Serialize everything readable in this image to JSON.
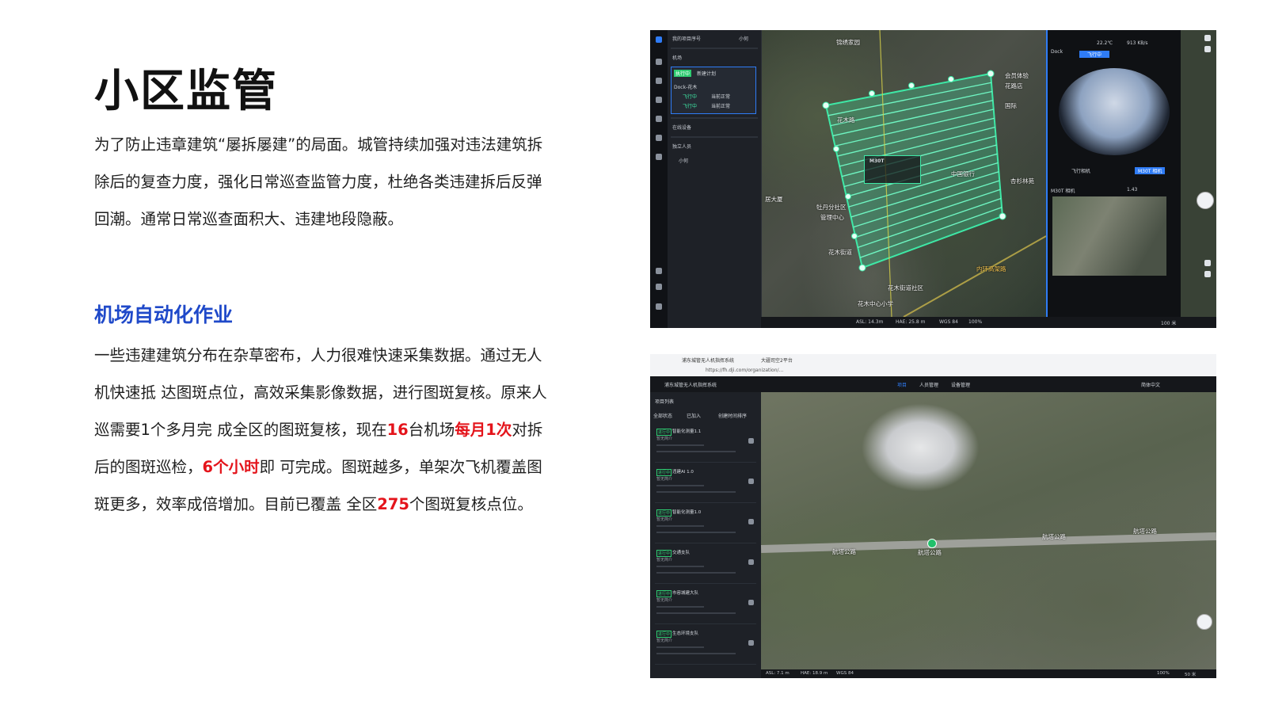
{
  "title": "小区监管",
  "intro": "为了防止违章建筑“屡拆屡建”的局面。城管持续加强对违法建筑拆除后的复查力度，强化日常巡查监管力度，杜绝各类违建拆后反弹回潮。通常日常巡查面积大、违建地段隐蔽。",
  "section_title": "机场自动化作业",
  "body": {
    "s1": "一些违建建筑分布在杂草密布，人力很难快速采集数据。通过无人机快速抵 达图斑点位，高效采集影像数据，进行图斑复核。原来人巡需要1个多月完 成全区的图斑复核，现在",
    "h1": "16",
    "s2": "台机场",
    "h2": "每月1次",
    "s3": "对拆后的图斑巡检，",
    "h3": "6个小时",
    "s4": "即  可完成。图斑越多，单架次飞机覆盖图斑更多，效率成倍增加。目前已覆盖 全区",
    "h4": "275",
    "s5": "个图斑复核点位。"
  },
  "screenshot1": {
    "panel": {
      "header": "我的项目序号",
      "user": "小何",
      "section_airport": "机场",
      "dock_name": "Dock-花木",
      "dock_status": "执行中",
      "task": "新建计划",
      "status_a": "飞行中",
      "status_b": "当前正常",
      "online_devices": "在线设备",
      "independent_members": "独立人员",
      "member": "小何"
    },
    "map_labels": [
      "锦绣家园",
      "花木路",
      "会员体验",
      "花路店",
      "国际",
      "花木街道",
      "杏杉林苑",
      "牡丹分社区",
      "管理中心",
      "居大厦",
      "中国银行",
      "花木中心小学",
      "内环高架路",
      "花木街道社区"
    ],
    "drone": "M30T",
    "right_panel": {
      "dock": "Dock",
      "status": "飞行中",
      "temp": "22.2℃",
      "speed": "913 KB/s",
      "camera": "M30T 相机",
      "mode": "飞行相机",
      "zoom": "1.43"
    },
    "status_bar": {
      "asl": "ASL: 14.3m",
      "hae": "HAE: 25.8 m",
      "crs": "WGS 84",
      "zoom": "100%",
      "scale": "100 米"
    }
  },
  "screenshot2": {
    "browser": {
      "tab1": "浦东城管无人机指挥系统",
      "tab2": "大疆司空2平台",
      "url": "https://fh.dji.com/organization/..."
    },
    "app": {
      "title": "浦东城管无人机指挥系统",
      "nav": [
        "项目",
        "人员管理",
        "设备管理"
      ],
      "lang": "简体中文"
    },
    "panel": {
      "header": "项目列表",
      "filters": [
        "全部状态",
        "已加入",
        "创建时间排序"
      ]
    },
    "cards": [
      {
        "tag": "进行中",
        "name": "智能化测量1.1",
        "sub": "暂无简介"
      },
      {
        "tag": "进行中",
        "name": "违建AI 1.0",
        "sub": "暂无简介"
      },
      {
        "tag": "进行中",
        "name": "智能化测量1.0",
        "sub": "暂无简介"
      },
      {
        "tag": "进行中",
        "name": "交通支队",
        "sub": "暂无简介"
      },
      {
        "tag": "进行中",
        "name": "市容城建大队",
        "sub": "暂无简介"
      },
      {
        "tag": "进行中",
        "name": "生态环境支队",
        "sub": "暂无简介"
      }
    ],
    "map_labels": [
      "航塔公路",
      "航塔公路",
      "航塔公路",
      "航塔公路"
    ],
    "status_bar": {
      "asl": "ASL: 7.1 m",
      "hae": "HAE: 18.9 m",
      "crs": "WGS 84",
      "zoom": "100%",
      "scale": "50 米"
    }
  },
  "colors": {
    "accent_blue": "#1f49c9",
    "highlight_red": "#e4141b",
    "route_green": "#3ee8a6",
    "ui_blue": "#2f7cf6"
  }
}
